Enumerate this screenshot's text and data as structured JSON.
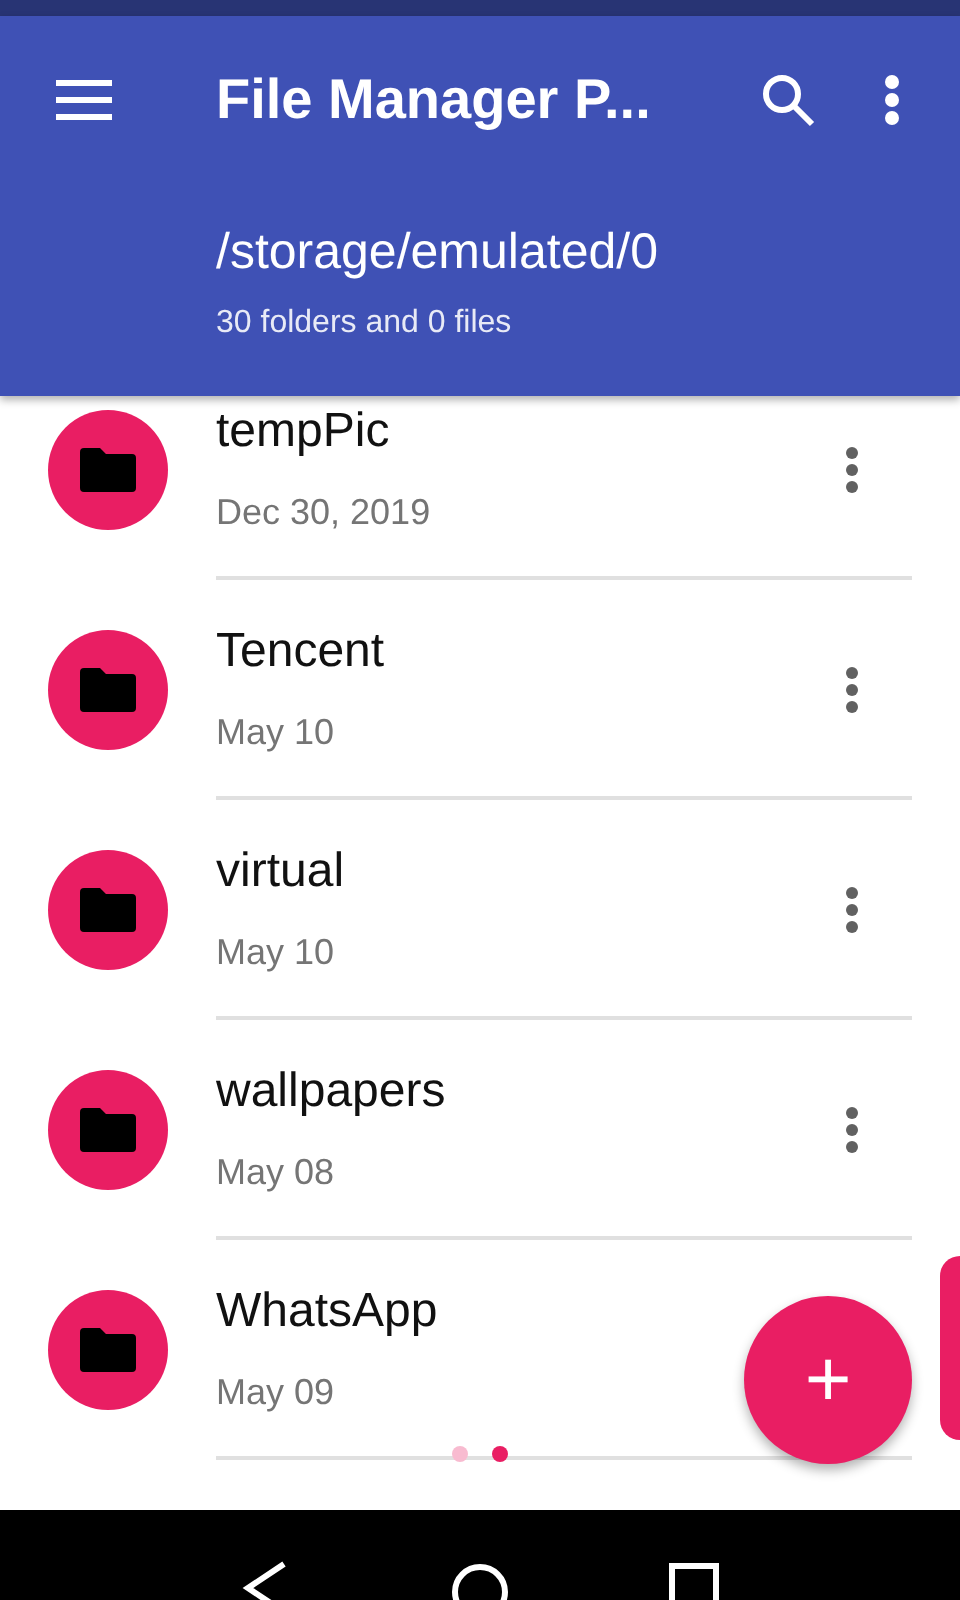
{
  "app_bar": {
    "title": "File Manager P...",
    "path": "/storage/emulated/0",
    "summary": "30 folders and 0 files"
  },
  "folders": [
    {
      "name": "tempPic",
      "date": "Dec 30, 2019"
    },
    {
      "name": "Tencent",
      "date": "May 10"
    },
    {
      "name": "virtual",
      "date": "May 10"
    },
    {
      "name": "wallpapers",
      "date": "May 08"
    },
    {
      "name": "WhatsApp",
      "date": "May 09"
    }
  ],
  "pager": [
    {
      "selected": false
    },
    {
      "selected": true
    }
  ],
  "fab": {
    "label": "+"
  }
}
